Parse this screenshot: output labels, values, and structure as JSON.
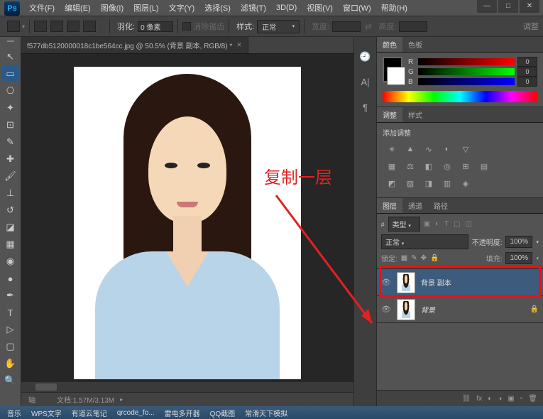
{
  "menu": [
    "文件(F)",
    "编辑(E)",
    "图像(I)",
    "图层(L)",
    "文字(Y)",
    "选择(S)",
    "滤镜(T)",
    "3D(D)",
    "视图(V)",
    "窗口(W)",
    "帮助(H)"
  ],
  "opt": {
    "feather_lbl": "羽化:",
    "feather_val": "0 像素",
    "antialias": "消除锯齿",
    "style_lbl": "样式:",
    "style_val": "正常",
    "width_lbl": "宽度:",
    "height_lbl": "高度:",
    "adjust_btn": "调整"
  },
  "tab": {
    "name": "f577db5120000018c1be564cc.jpg @ 50.5% (背景 副本, RGB/8) *"
  },
  "status": {
    "zoom": "轴",
    "doc": "文档:1.57M/3.13M"
  },
  "annotation": "复制一层",
  "color_panel": {
    "tabs": [
      "颜色",
      "色板"
    ],
    "r": {
      "lbl": "R",
      "val": "0"
    },
    "g": {
      "lbl": "G",
      "val": "0"
    },
    "b": {
      "lbl": "B",
      "val": "0"
    }
  },
  "adjust_panel": {
    "tabs": [
      "调整",
      "样式"
    ],
    "title": "添加调整"
  },
  "layers_panel": {
    "tabs": [
      "图层",
      "通道",
      "路径"
    ],
    "kind": "类型",
    "blend": "正常",
    "opacity_lbl": "不透明度:",
    "opacity_val": "100%",
    "lock_lbl": "锁定:",
    "fill_lbl": "填充:",
    "fill_val": "100%",
    "layers": [
      {
        "name": "背景 副本",
        "selected": true,
        "locked": false
      },
      {
        "name": "背景",
        "selected": false,
        "locked": true,
        "italic": true
      }
    ]
  },
  "taskbar": [
    "音乐",
    "WPS文字",
    "有道云笔记",
    "qrcode_fo...",
    "雷电多开器",
    "QQ截图",
    "常滑天下模拟"
  ],
  "chart_data": null
}
